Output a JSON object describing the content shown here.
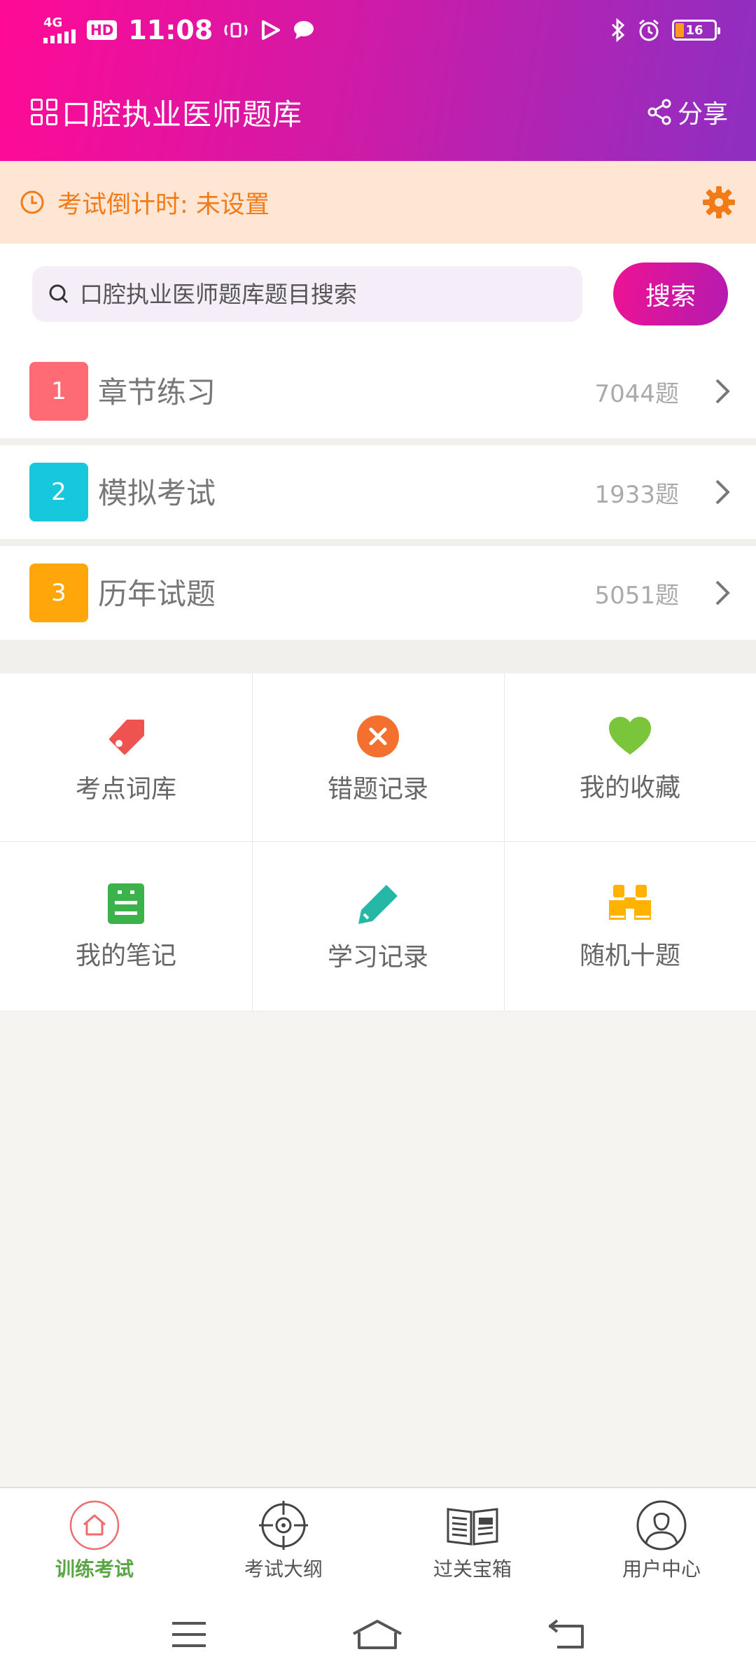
{
  "status_bar": {
    "network": "4G",
    "hd": "HD",
    "time": "11:08",
    "battery": "16"
  },
  "app_bar": {
    "title": "口腔执业医师题库",
    "share_label": "分享"
  },
  "countdown": {
    "text": "考试倒计时: 未设置",
    "accent": "#f27b17"
  },
  "search": {
    "placeholder": "口腔执业医师题库题目搜索",
    "button_label": "搜索"
  },
  "practice_items": [
    {
      "number": "1",
      "label": "章节练习",
      "count": "7044题",
      "color": "#ff6b74"
    },
    {
      "number": "2",
      "label": "模拟考试",
      "count": "1933题",
      "color": "#17c8dc"
    },
    {
      "number": "3",
      "label": "历年试题",
      "count": "5051题",
      "color": "#ffa60a"
    }
  ],
  "tools": [
    {
      "label": "考点词库",
      "icon": "tag-icon",
      "color": "#ef5350"
    },
    {
      "label": "错题记录",
      "icon": "close-circle-icon",
      "color": "#f4702f"
    },
    {
      "label": "我的收藏",
      "icon": "heart-icon",
      "color": "#7bc53b"
    },
    {
      "label": "我的笔记",
      "icon": "notebook-icon",
      "color": "#3cb34a"
    },
    {
      "label": "学习记录",
      "icon": "pencil-icon",
      "color": "#27b7a6"
    },
    {
      "label": "随机十题",
      "icon": "binoculars-icon",
      "color": "#ffb300"
    }
  ],
  "bottom_nav": [
    {
      "label": "训练考试",
      "icon": "home-icon",
      "active": true
    },
    {
      "label": "考试大纲",
      "icon": "target-icon",
      "active": false
    },
    {
      "label": "过关宝箱",
      "icon": "news-book-icon",
      "active": false
    },
    {
      "label": "用户中心",
      "icon": "user-icon",
      "active": false
    }
  ],
  "colors": {
    "header_start": "#ff0a96",
    "header_end": "#8d2fc2",
    "active_nav": "#5aa644"
  }
}
